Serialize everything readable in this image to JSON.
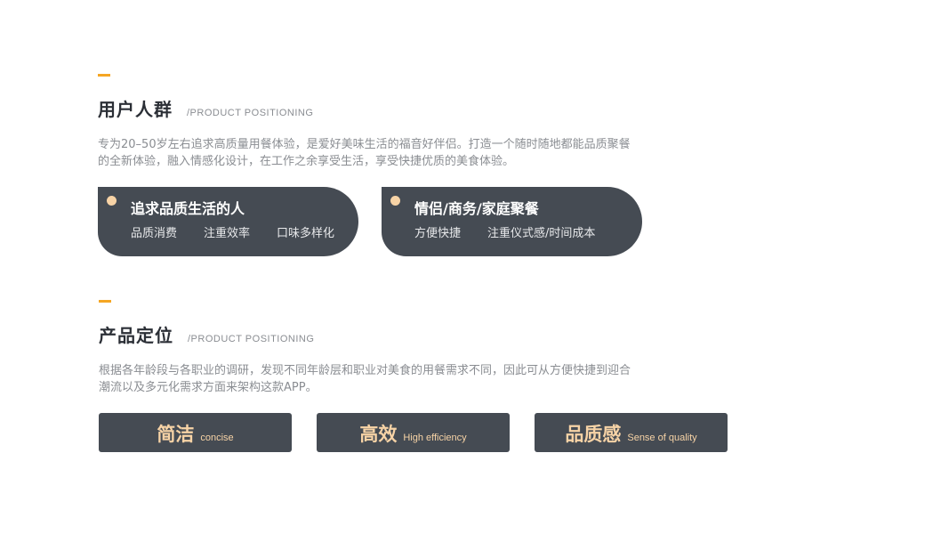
{
  "colors": {
    "accent": "#f5a623",
    "card_bg": "#454b53",
    "highlight": "#f7d3a6",
    "title": "#2b2f36",
    "muted": "#8a8d92"
  },
  "users": {
    "title": "用户人群",
    "subtitle": "/PRODUCT POSITIONING",
    "desc_line1": "专为20–50岁左右追求高质量用餐体验，是爱好美味生活的福音好伴侣。打造一个随时随地都能品质聚餐",
    "desc_line2": "的全新体验，融入情感化设计，在工作之余享受生活，享受快捷优质的美食体验。",
    "groups": [
      {
        "title": "追求品质生活的人",
        "tags": [
          "品质消费",
          "注重效率",
          "口味多样化"
        ]
      },
      {
        "title": "情侣/商务/家庭聚餐",
        "tags": [
          "方便快捷",
          "注重仪式感/时间成本"
        ]
      }
    ]
  },
  "positioning": {
    "title": "产品定位",
    "subtitle": "/PRODUCT POSITIONING",
    "desc_line1": "根据各年龄段与各职业的调研，发现不同年龄层和职业对美食的用餐需求不同，因此可从方便快捷到迎合",
    "desc_line2": "潮流以及多元化需求方面来架构这款APP。",
    "values": [
      {
        "zh": "简洁",
        "en": "concise"
      },
      {
        "zh": "高效",
        "en": "High efficiency"
      },
      {
        "zh": "品质感",
        "en": "Sense of quality"
      }
    ]
  }
}
